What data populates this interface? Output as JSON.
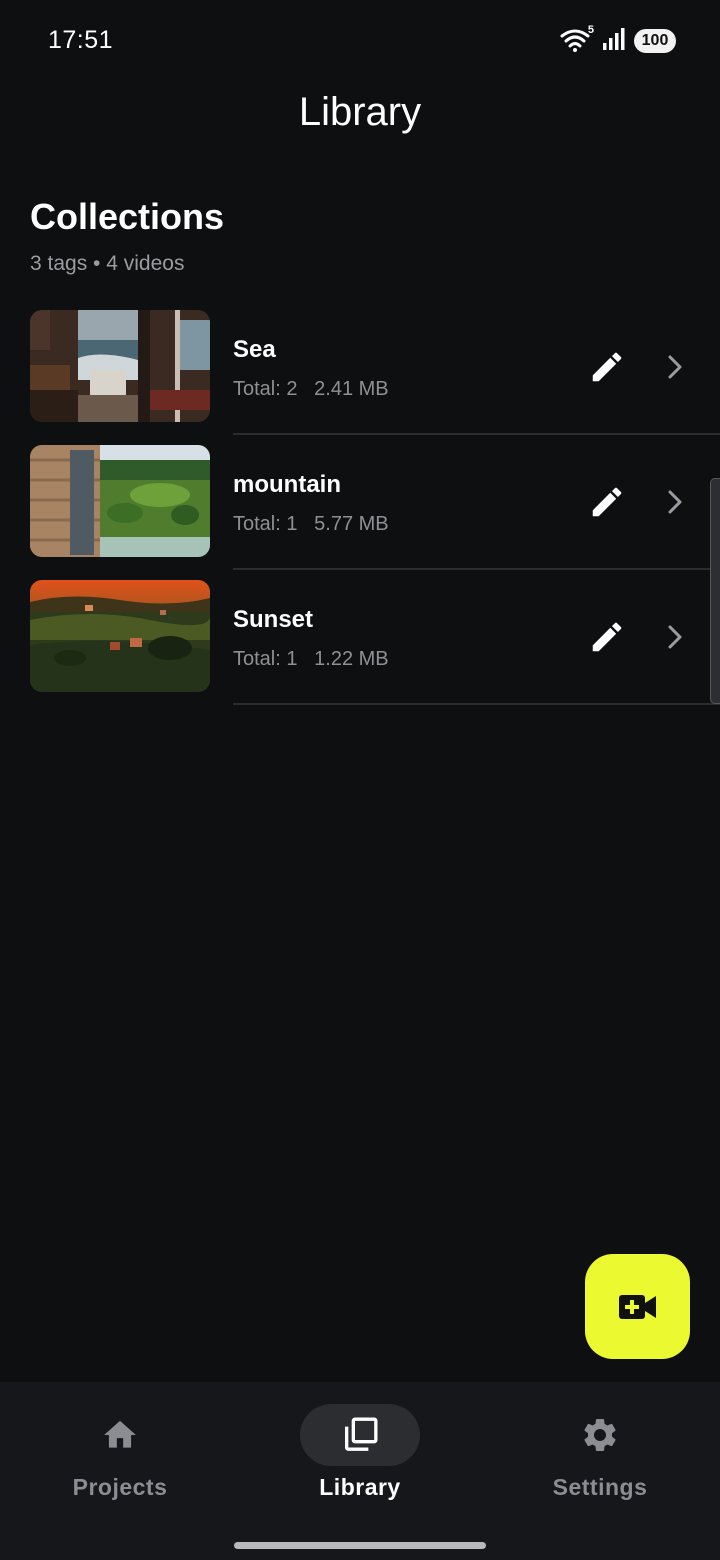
{
  "status_bar": {
    "time": "17:51",
    "battery": "100",
    "wifi_badge": "5"
  },
  "header": {
    "title": "Library"
  },
  "collections": {
    "title": "Collections",
    "subtitle": "3 tags • 4 videos",
    "items": [
      {
        "name": "Sea",
        "meta": "Total: 2   2.41 MB",
        "thumbnail": "sea-room-photo"
      },
      {
        "name": "mountain",
        "meta": "Total: 1   5.77 MB",
        "thumbnail": "mountain-meadow-photo"
      },
      {
        "name": "Sunset",
        "meta": "Total: 1   1.22 MB",
        "thumbnail": "sunset-village-photo"
      }
    ]
  },
  "fab": {
    "icon": "add-video-icon",
    "color": "#eaf930"
  },
  "bottom_nav": {
    "items": [
      {
        "label": "Projects",
        "icon": "home-icon",
        "active": false
      },
      {
        "label": "Library",
        "icon": "library-icon",
        "active": true
      },
      {
        "label": "Settings",
        "icon": "gear-icon",
        "active": false
      }
    ]
  },
  "colors": {
    "background": "#0e0f11",
    "accent": "#eaf930",
    "muted_text": "#8e9095"
  }
}
